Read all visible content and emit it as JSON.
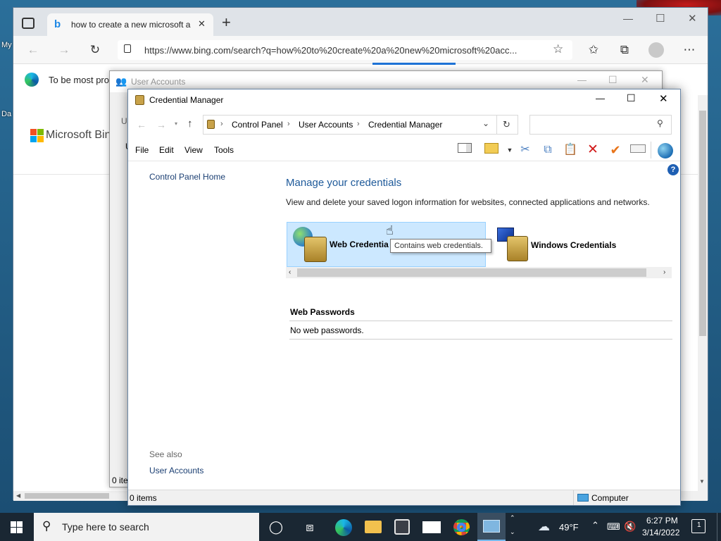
{
  "desktop": {
    "icon_labels": [
      "My",
      "Da"
    ]
  },
  "edge": {
    "tab_title": "how to create a new microsoft a",
    "new_tab_symbol": "+",
    "window_controls": {
      "minimize": "—",
      "maximize": "☐",
      "close": "✕"
    },
    "address_url": "https://www.bing.com/search?q=how%20to%20create%20a%20new%20microsoft%20acc...",
    "info_text": "To be most pro",
    "bing_brand": "Microsoft Bing"
  },
  "user_accounts": {
    "title": "User Accounts",
    "status_partial": "0 ite",
    "left_letters": [
      "U",
      "U"
    ]
  },
  "credential_manager": {
    "title": "Credential Manager",
    "breadcrumb": [
      "Control Panel",
      "User Accounts",
      "Credential Manager"
    ],
    "search_placeholder": "",
    "menu": [
      "File",
      "Edit",
      "View",
      "Tools"
    ],
    "sidebar": {
      "home_link": "Control Panel Home",
      "see_also_heading": "See also",
      "see_also_links": [
        "User Accounts"
      ]
    },
    "main": {
      "heading": "Manage your credentials",
      "description": "View and delete your saved logon information for websites, connected applications and networks.",
      "web_credentials_label": "Web Credentials",
      "windows_credentials_label": "Windows Credentials",
      "tooltip": "Contains web credentials.",
      "section_heading": "Web Passwords",
      "section_empty": "No web passwords."
    },
    "status": {
      "items": "0 items",
      "location": "Computer"
    }
  },
  "taskbar": {
    "search_placeholder": "Type here to search",
    "weather": "49°F",
    "time": "6:27 PM",
    "date": "3/14/2022",
    "notification_count": "1"
  },
  "colors": {
    "accent_blue": "#1e5a9a",
    "selected_tile": "#cce8ff",
    "taskbar": "#1a2733",
    "delete_red": "#d11a1a",
    "check_orange": "#e8741a"
  }
}
